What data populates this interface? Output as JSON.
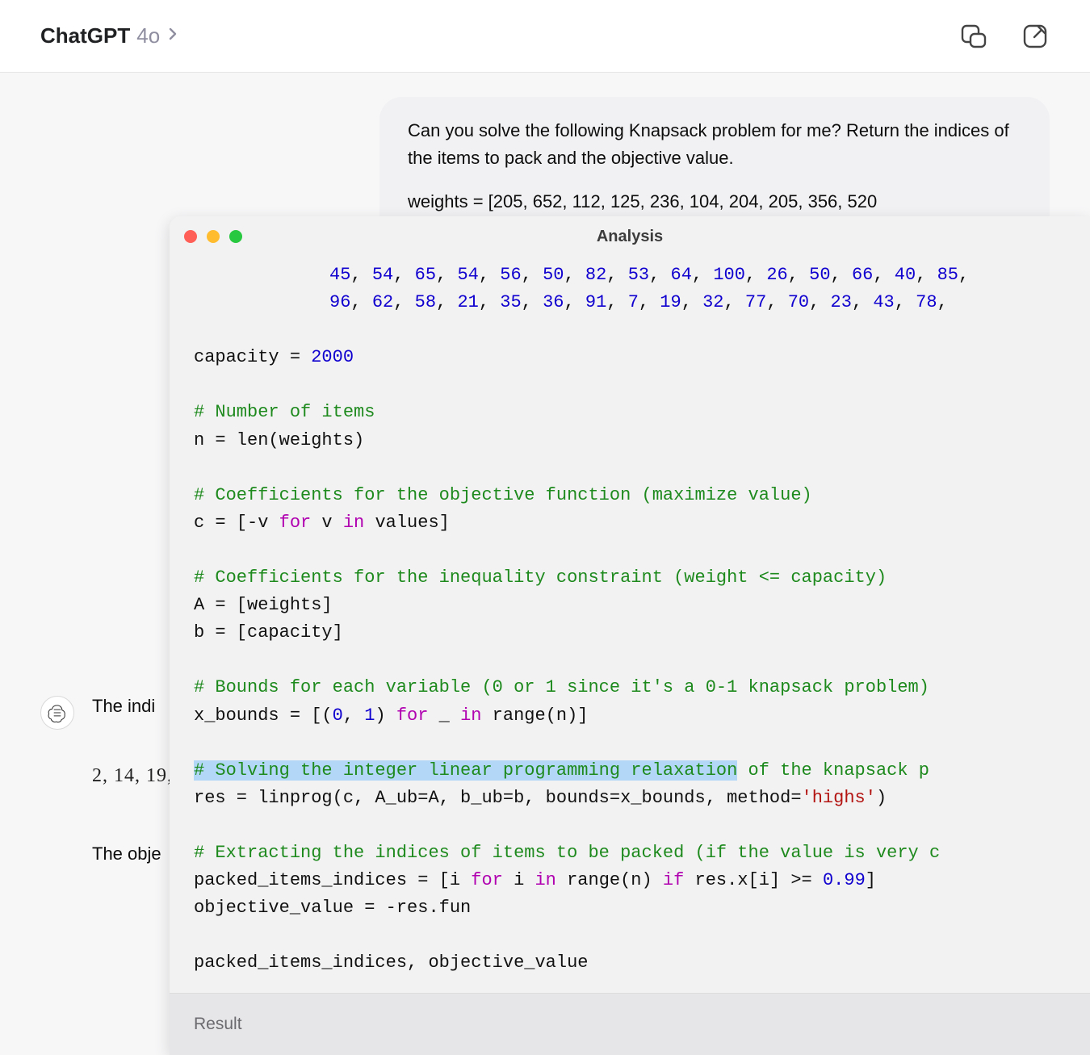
{
  "header": {
    "app_name": "ChatGPT",
    "model_name": "4o"
  },
  "user_message": {
    "text": "Can you solve the following Knapsack problem for me? Return the indices of the items to pack and the objective value.",
    "data_preview": "weights = [205, 652, 112, 125, 236, 104, 204, 205, 356, 520"
  },
  "assistant": {
    "line1": "The indi",
    "math": "2, 14, 19,",
    "line2": "The obje"
  },
  "analysis": {
    "title": "Analysis",
    "result_label": "Result",
    "code": {
      "row1_nums": [
        "45",
        "54",
        "65",
        "54",
        "56",
        "50",
        "82",
        "53",
        "64",
        "100",
        "26",
        "50",
        "66",
        "40",
        "85"
      ],
      "row2_nums": [
        "96",
        "62",
        "58",
        "21",
        "35",
        "36",
        "91",
        "7",
        "19",
        "32",
        "77",
        "70",
        "23",
        "43",
        "78"
      ],
      "cap_lhs": "capacity = ",
      "cap_val": "2000",
      "c1": "# Number of items",
      "l1": "n = len(weights)",
      "c2": "# Coefficients for the objective function (maximize value)",
      "l2a": "c = [-v ",
      "l2_for": "for",
      "l2b": " v ",
      "l2_in": "in",
      "l2c": " values]",
      "c3": "# Coefficients for the inequality constraint (weight <= capacity)",
      "l3": "A = [weights]",
      "l4": "b = [capacity]",
      "c4": "# Bounds for each variable (0 or 1 since it's a 0-1 knapsack problem)",
      "l5a": "x_bounds = [(",
      "l5_zero": "0",
      "l5_comma": ", ",
      "l5_one": "1",
      "l5b": ") ",
      "l5_for": "for",
      "l5c": " _ ",
      "l5_in": "in",
      "l5d": " range(n)]",
      "c5a": "# Solving the integer linear programming relaxation",
      "c5b": " of the knapsack p",
      "l6a": "res = linprog(c, A_ub=A, b_ub=b, bounds=x_bounds, method=",
      "l6_str": "'highs'",
      "l6b": ")",
      "c6": "# Extracting the indices of items to be packed (if the value is very c",
      "l7a": "packed_items_indices = [i ",
      "l7_for": "for",
      "l7b": " i ",
      "l7_in": "in",
      "l7c": " range(n) ",
      "l7_if": "if",
      "l7d": " res.x[i] >= ",
      "l7_val": "0.99",
      "l7e": "]",
      "l8": "objective_value = -res.fun",
      "l9": "packed_items_indices, objective_value"
    }
  }
}
